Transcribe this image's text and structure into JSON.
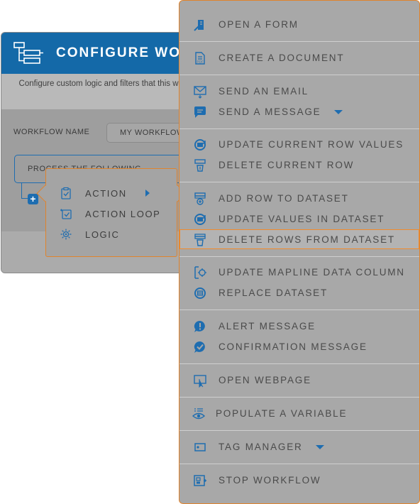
{
  "panel": {
    "title": "CONFIGURE WO",
    "description": "Configure custom logic and filters that this work",
    "workflow_name_label": "WORKFLOW NAME",
    "workflow_name_value": "MY WORKFLOW",
    "process_text": "PROCESS THE FOLLOWING",
    "add_label": "+",
    "header_color": "#1469a8"
  },
  "submenu": {
    "items": [
      {
        "label": "ACTION",
        "icon": "clipboard-check-icon"
      },
      {
        "label": "ACTION LOOP",
        "icon": "loop-check-icon"
      },
      {
        "label": "LOGIC",
        "icon": "gear-logic-icon"
      }
    ]
  },
  "menu": {
    "items": [
      {
        "label": "OPEN A FORM",
        "icon": "form-pen-icon"
      },
      {
        "label": "CREATE A DOCUMENT",
        "icon": "pdf-document-icon"
      },
      {
        "label": "SEND AN EMAIL",
        "icon": "envelope-icon"
      },
      {
        "label": "SEND A MESSAGE",
        "icon": "chat-bubble-icon"
      },
      {
        "label": "UPDATE CURRENT ROW VALUES",
        "icon": "refresh-db-icon"
      },
      {
        "label": "DELETE CURRENT ROW",
        "icon": "delete-row-icon"
      },
      {
        "label": "ADD ROW TO DATASET",
        "icon": "add-row-icon"
      },
      {
        "label": "UPDATE VALUES IN DATASET",
        "icon": "refresh-db-icon"
      },
      {
        "label": "DELETE ROWS FROM DATASET",
        "icon": "delete-rows-icon"
      },
      {
        "label": "UPDATE MAPLINE DATA COLUMN",
        "icon": "column-gear-icon"
      },
      {
        "label": "REPLACE DATASET",
        "icon": "replace-db-icon"
      },
      {
        "label": "ALERT MESSAGE",
        "icon": "alert-bubble-icon"
      },
      {
        "label": "CONFIRMATION MESSAGE",
        "icon": "check-bubble-icon"
      },
      {
        "label": "OPEN WEBPAGE",
        "icon": "monitor-cursor-icon"
      },
      {
        "label": "POPULATE A VARIABLE",
        "icon": "eye-list-icon"
      },
      {
        "label": "TAG MANAGER",
        "icon": "tag-icon"
      },
      {
        "label": "STOP WORKFLOW",
        "icon": "stop-workflow-icon"
      }
    ],
    "highlighted": "DELETE ROWS FROM DATASET",
    "accent_color": "#e0832c"
  }
}
